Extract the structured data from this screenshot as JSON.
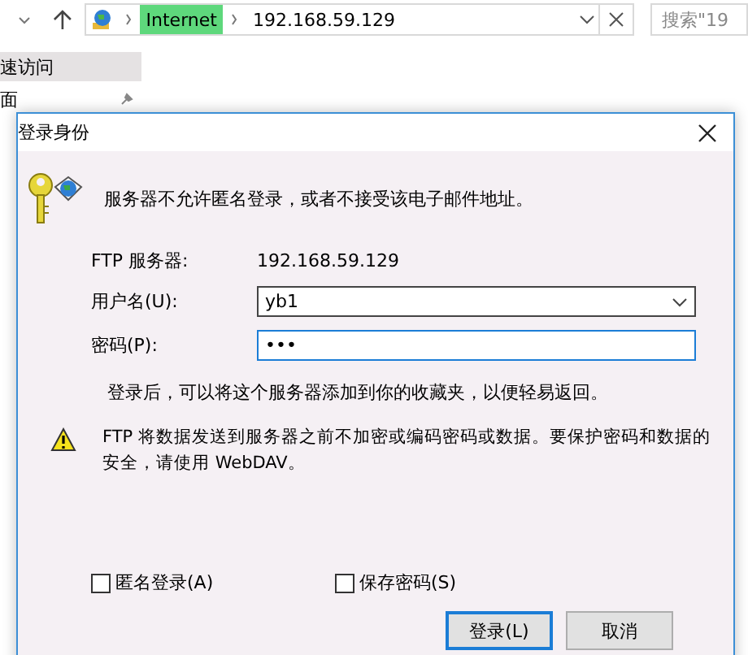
{
  "explorer": {
    "breadcrumbs": [
      {
        "label": "Internet",
        "selected": true
      },
      {
        "label": "192.168.59.129",
        "selected": false
      }
    ],
    "search": {
      "placeholder": "搜索\"19"
    },
    "sidebar": {
      "items": [
        {
          "label": "速访问",
          "selected": true
        },
        {
          "label": "面",
          "selected": false
        }
      ]
    }
  },
  "dialog": {
    "title": "登录身份",
    "message": "服务器不允许匿名登录，或者不接受该电子邮件地址。",
    "fields": [
      {
        "kind": "static",
        "label": "FTP 服务器:",
        "value": "192.168.59.129"
      },
      {
        "kind": "combo",
        "label": "用户名(U):",
        "value": "yb1"
      },
      {
        "kind": "password",
        "label": "密码(P):",
        "value": "•••",
        "focused": true
      }
    ],
    "note": "登录后，可以将这个服务器添加到你的收藏夹，以便轻易返回。",
    "warning": "FTP 将数据发送到服务器之前不加密或编码密码或数据。要保护密码和数据的安全，请使用 WebDAV。",
    "checkboxes": [
      {
        "label": "匿名登录(A)",
        "checked": false
      },
      {
        "label": "保存密码(S)",
        "checked": false
      }
    ],
    "buttons": [
      {
        "label": "登录(L)",
        "default": true
      },
      {
        "label": "取消",
        "default": false
      }
    ]
  }
}
